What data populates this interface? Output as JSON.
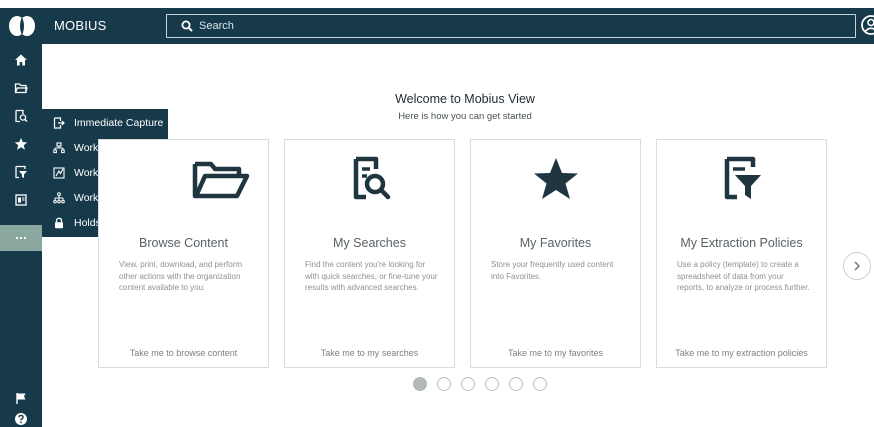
{
  "app": {
    "name": "MOBIUS"
  },
  "search": {
    "placeholder": "Search"
  },
  "sidebar": {
    "items": [
      {
        "name": "home",
        "icon": "home-icon"
      },
      {
        "name": "folder",
        "icon": "folder-icon"
      },
      {
        "name": "searches",
        "icon": "document-search-icon"
      },
      {
        "name": "favorites",
        "icon": "star-icon"
      },
      {
        "name": "extraction",
        "icon": "filter-document-icon"
      },
      {
        "name": "reports",
        "icon": "report-icon"
      },
      {
        "name": "more",
        "icon": "more-icon",
        "label": "···"
      }
    ],
    "bottom": [
      {
        "name": "flag",
        "icon": "flag-icon"
      },
      {
        "name": "help",
        "icon": "help-icon"
      }
    ]
  },
  "flyout": {
    "items": [
      {
        "label": "Immediate Capture",
        "icon": "capture-icon"
      },
      {
        "label": "Workflow Inbox",
        "icon": "workflow-inbox-icon"
      },
      {
        "label": "Workflow Designer",
        "icon": "workflow-designer-icon"
      },
      {
        "label": "Workflow Monitor",
        "icon": "workflow-monitor-icon"
      },
      {
        "label": "Holds",
        "icon": "lock-icon"
      }
    ]
  },
  "welcome": {
    "title": "Welcome to Mobius View",
    "subtitle": "Here is how you can get started"
  },
  "cards": [
    {
      "title": "Browse Content",
      "description": "View, print, download, and perform other actions with the organization content available to you.",
      "link": "Take me to browse content",
      "icon": "folder-open-icon"
    },
    {
      "title": "My Searches",
      "description": "Find the content you're looking for with quick searches, or fine-tune your results with advanced searches.",
      "link": "Take me to my searches",
      "icon": "document-search-icon"
    },
    {
      "title": "My Favorites",
      "description": "Store your frequently used content into Favorites.",
      "link": "Take me to my favorites",
      "icon": "star-icon"
    },
    {
      "title": "My Extraction Policies",
      "description": "Use a policy (template) to create a spreadsheet of data from your reports, to analyze or process further.",
      "link": "Take me to my extraction policies",
      "icon": "filter-document-icon"
    }
  ],
  "pager": {
    "count": 6,
    "active": 0
  },
  "colors": {
    "nav": "#173a4a",
    "active": "#8aa8a0",
    "accent": "#1f3540"
  }
}
